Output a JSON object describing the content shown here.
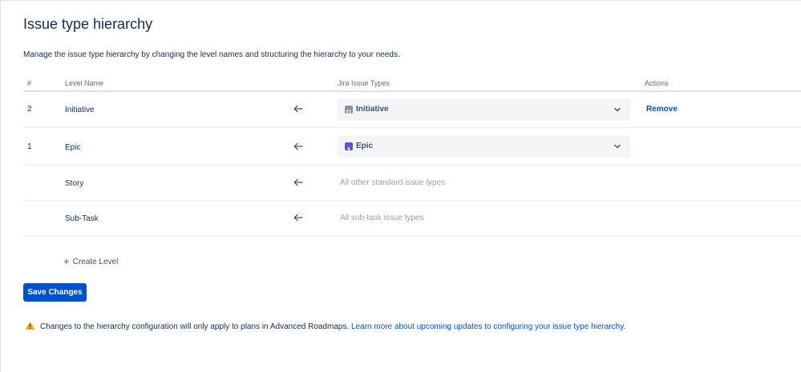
{
  "page": {
    "title": "Issue type hierarchy",
    "description": "Manage the issue type hierarchy by changing the level names and structuring the hierarchy to your needs."
  },
  "table": {
    "headers": {
      "num": "#",
      "level_name": "Level Name",
      "issue_types": "Jira Issue Types",
      "actions": "Actions"
    },
    "rows": [
      {
        "num": "2",
        "name": "Initiative",
        "issue_type": "Initiative",
        "icon_color": "#8993a4",
        "action": "Remove"
      },
      {
        "num": "1",
        "name": "Epic",
        "issue_type": "Epic",
        "icon_color": "#6554c0",
        "action": ""
      },
      {
        "num": "",
        "name": "Story",
        "hint": "All other standard issue types"
      },
      {
        "num": "",
        "name": "Sub-Task",
        "hint": "All sub-task issue types"
      }
    ]
  },
  "create_level_label": "Create Level",
  "save_label": "Save Changes",
  "notice": {
    "text": "Changes to the hierarchy configuration will only apply to plans in Advanced Roadmaps.",
    "link_text": "Learn more about upcoming updates to configuring your issue type hierarchy."
  },
  "colors": {
    "primary": "#0052cc",
    "warning": "#ffab00"
  },
  "icons": [
    "arrow-left-icon",
    "chevron-down-icon",
    "plus-icon",
    "warning-icon",
    "initiative-icon",
    "epic-icon"
  ]
}
